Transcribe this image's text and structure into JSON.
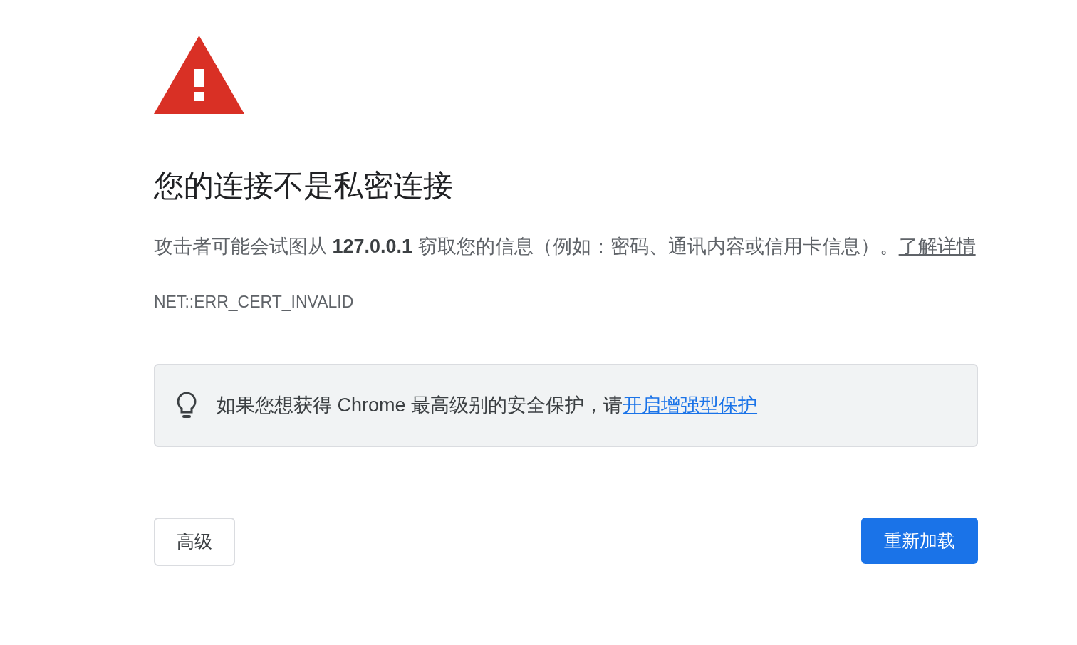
{
  "heading": "您的连接不是私密连接",
  "description": {
    "text": "攻击者可能会试图从 **127.0.0.1** 窃取您的信息（例如：密码、通讯内容或信用卡信息）。",
    "link": "了解详情"
  },
  "error_code": "NET::ERR_CERT_INVALID",
  "tip": {
    "text": "如果您想获得 Chrome 最高级别的安全保护，请",
    "link": "开启增强型保护"
  },
  "buttons": [
    {
      "label": "高级",
      "kind": "secondary"
    },
    {
      "label": "重新加载",
      "kind": "primary"
    }
  ]
}
